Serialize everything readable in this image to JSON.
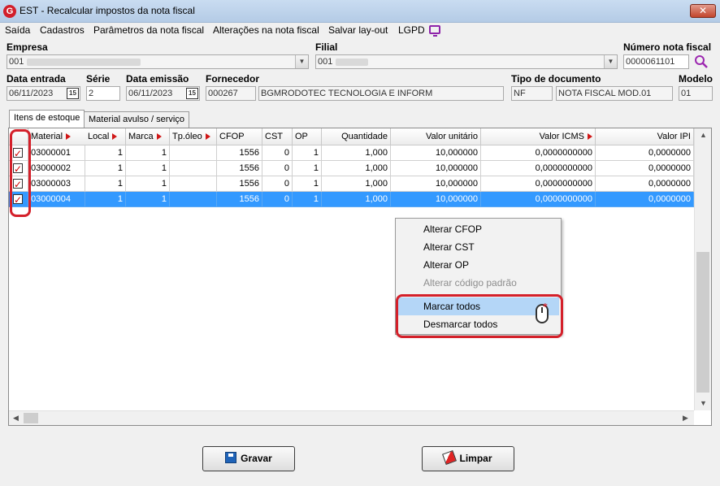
{
  "window": {
    "app_icon": "G",
    "title": "EST - Recalcular impostos da nota fiscal",
    "close_icon": "✕"
  },
  "menu": {
    "items": [
      "Saída",
      "Cadastros",
      "Parâmetros da nota fiscal",
      "Alterações na nota fiscal",
      "Salvar lay-out",
      "LGPD"
    ],
    "lgpd_icon": "monitor-icon"
  },
  "form": {
    "empresa": {
      "label": "Empresa",
      "value": "001"
    },
    "filial": {
      "label": "Filial",
      "value": "001"
    },
    "numero_nota": {
      "label": "Número nota fiscal",
      "value": "0000061101"
    },
    "data_entrada": {
      "label": "Data entrada",
      "value": "06/11/2023"
    },
    "serie": {
      "label": "Série",
      "value": "2"
    },
    "data_emissao": {
      "label": "Data emissão",
      "value": "06/11/2023"
    },
    "fornecedor": {
      "label": "Fornecedor",
      "code": "000267",
      "name": "BGMRODOTEC TECNOLOGIA E INFORM"
    },
    "tipo_documento": {
      "label": "Tipo de documento",
      "code": "NF",
      "name": "NOTA FISCAL MOD.01"
    },
    "modelo": {
      "label": "Modelo",
      "value": "01"
    },
    "calendar_glyph": "15",
    "combo_glyph": "▼"
  },
  "tabs": [
    {
      "label": "Itens de estoque",
      "active": true
    },
    {
      "label": "Material avulso / serviço",
      "active": false
    }
  ],
  "grid": {
    "columns": [
      "",
      "Material",
      "Local",
      "Marca",
      "Tp.óleo",
      "CFOP",
      "CST",
      "OP",
      "Quantidade",
      "Valor unitário",
      "Valor ICMS",
      "Valor IPI"
    ],
    "rows": [
      {
        "checked": true,
        "material": "03000001",
        "local": "1",
        "marca": "1",
        "tp_oleo": "",
        "cfop": "1556",
        "cst": "0",
        "op": "1",
        "quantidade": "1,000",
        "valor_unitario": "10,000000",
        "valor_icms": "0,0000000000",
        "valor_ipi": "0,0000000"
      },
      {
        "checked": true,
        "material": "03000002",
        "local": "1",
        "marca": "1",
        "tp_oleo": "",
        "cfop": "1556",
        "cst": "0",
        "op": "1",
        "quantidade": "1,000",
        "valor_unitario": "10,000000",
        "valor_icms": "0,0000000000",
        "valor_ipi": "0,0000000"
      },
      {
        "checked": true,
        "material": "03000003",
        "local": "1",
        "marca": "1",
        "tp_oleo": "",
        "cfop": "1556",
        "cst": "0",
        "op": "1",
        "quantidade": "1,000",
        "valor_unitario": "10,000000",
        "valor_icms": "0,0000000000",
        "valor_ipi": "0,0000000"
      },
      {
        "checked": true,
        "material": "03000004",
        "local": "1",
        "marca": "1",
        "tp_oleo": "",
        "cfop": "1556",
        "cst": "0",
        "op": "1",
        "quantidade": "1,000",
        "valor_unitario": "10,000000",
        "valor_icms": "0,0000000000",
        "valor_ipi": "0,0000000",
        "selected": true
      }
    ]
  },
  "context_menu": {
    "items": [
      {
        "label": "Alterar CFOP",
        "enabled": true
      },
      {
        "label": "Alterar CST",
        "enabled": true
      },
      {
        "label": "Alterar OP",
        "enabled": true
      },
      {
        "label": "Alterar código padrão",
        "enabled": false
      },
      {
        "label": "Marcar todos",
        "enabled": true,
        "hover": true
      },
      {
        "label": "Desmarcar todos",
        "enabled": true
      }
    ]
  },
  "buttons": {
    "gravar": "Gravar",
    "limpar": "Limpar"
  },
  "colors": {
    "selection": "#3399ff",
    "highlight": "#d4202a",
    "sort_indicator": "#d01818"
  }
}
